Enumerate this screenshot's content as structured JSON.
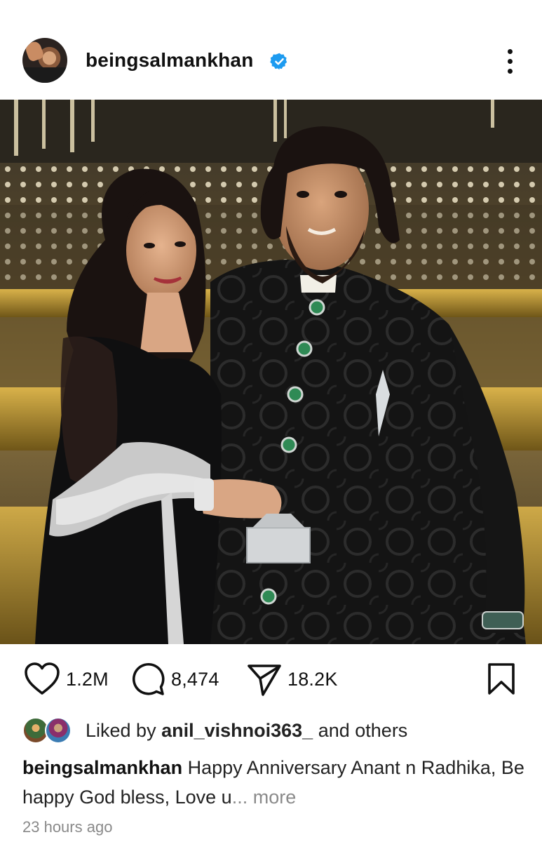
{
  "post": {
    "username": "beingsalmankhan",
    "verified": true,
    "image": {
      "description_icon": "photo"
    },
    "actions": {
      "likes": "1.2M",
      "comments": "8,474",
      "shares": "18.2K"
    },
    "liked_by": {
      "prefix": "Liked by",
      "user": "anil_vishnoi363_",
      "suffix": "and others"
    },
    "caption": {
      "username": "beingsalmankhan",
      "text": "Happy Anniversary Anant n Radhika, Be happy God bless, Love u",
      "ellipsis": "...",
      "more_label": "more"
    },
    "timestamp": "23 hours ago"
  },
  "colors": {
    "verified_blue": "#1d9bf0",
    "text_primary": "#111111",
    "text_muted": "#8a8a8a"
  },
  "icons": {
    "like": "heart-outline-icon",
    "comment": "speech-bubble-icon",
    "share": "paper-plane-icon",
    "save": "bookmark-icon",
    "more": "vertical-ellipsis-icon",
    "verified": "verified-badge-icon"
  }
}
